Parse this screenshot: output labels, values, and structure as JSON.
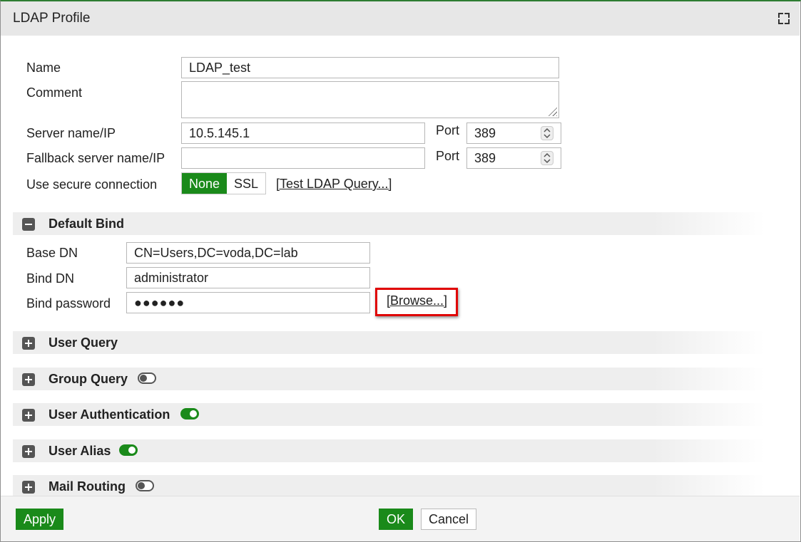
{
  "dialog": {
    "title": "LDAP Profile"
  },
  "form": {
    "name_label": "Name",
    "name_value": "LDAP_test",
    "comment_label": "Comment",
    "comment_value": "",
    "server_label": "Server name/IP",
    "server_value": "10.5.145.1",
    "port_label": "Port",
    "port_value": "389",
    "fallback_label": "Fallback server name/IP",
    "fallback_value": "",
    "fallback_port_label": "Port",
    "fallback_port_value": "389",
    "secure_label": "Use secure connection",
    "secure_options": [
      "None",
      "SSL"
    ],
    "secure_selected": "None",
    "test_link": "[Test LDAP Query...]"
  },
  "default_bind": {
    "title": "Default Bind",
    "expanded": true,
    "base_dn_label": "Base DN",
    "base_dn_value": "CN=Users,DC=voda,DC=lab",
    "bind_dn_label": "Bind DN",
    "bind_dn_value": "administrator",
    "bind_password_label": "Bind password",
    "bind_password_value": "●●●●●●",
    "browse_link": "[Browse...]"
  },
  "sections": [
    {
      "title": "User Query",
      "toggle": null
    },
    {
      "title": "Group Query",
      "toggle": "off"
    },
    {
      "title": "User Authentication",
      "toggle": "on"
    },
    {
      "title": "User Alias",
      "toggle": "on"
    },
    {
      "title": "Mail Routing",
      "toggle": "off"
    }
  ],
  "footer": {
    "apply": "Apply",
    "ok": "OK",
    "cancel": "Cancel"
  },
  "colors": {
    "accent_green": "#1a8a1a",
    "highlight_red": "#e00000",
    "header_gray": "#e7e7e7"
  },
  "icons": {
    "maximize": "maximize-icon",
    "collapse": "minus-box-icon",
    "expand": "plus-box-icon"
  }
}
